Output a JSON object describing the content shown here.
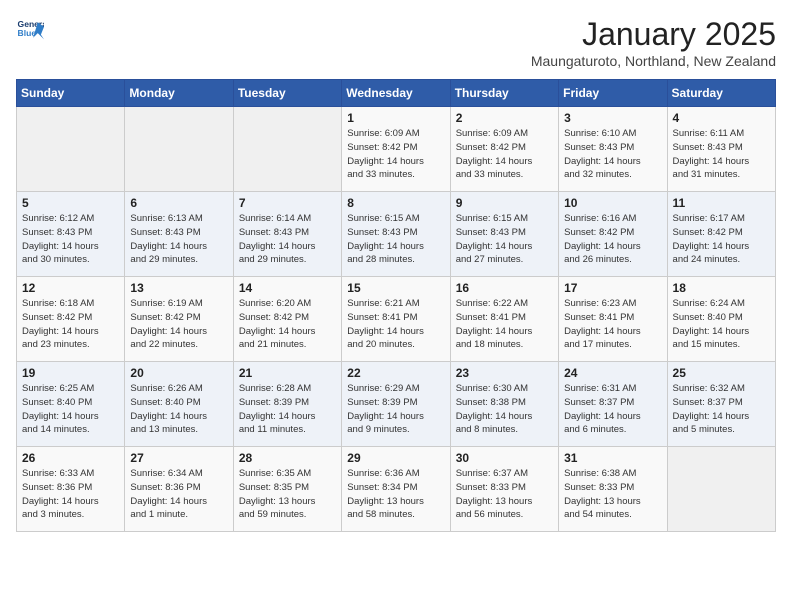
{
  "header": {
    "logo_general": "General",
    "logo_blue": "Blue",
    "month": "January 2025",
    "location": "Maungaturoto, Northland, New Zealand"
  },
  "weekdays": [
    "Sunday",
    "Monday",
    "Tuesday",
    "Wednesday",
    "Thursday",
    "Friday",
    "Saturday"
  ],
  "weeks": [
    [
      {
        "day": "",
        "info": ""
      },
      {
        "day": "",
        "info": ""
      },
      {
        "day": "",
        "info": ""
      },
      {
        "day": "1",
        "info": "Sunrise: 6:09 AM\nSunset: 8:42 PM\nDaylight: 14 hours\nand 33 minutes."
      },
      {
        "day": "2",
        "info": "Sunrise: 6:09 AM\nSunset: 8:42 PM\nDaylight: 14 hours\nand 33 minutes."
      },
      {
        "day": "3",
        "info": "Sunrise: 6:10 AM\nSunset: 8:43 PM\nDaylight: 14 hours\nand 32 minutes."
      },
      {
        "day": "4",
        "info": "Sunrise: 6:11 AM\nSunset: 8:43 PM\nDaylight: 14 hours\nand 31 minutes."
      }
    ],
    [
      {
        "day": "5",
        "info": "Sunrise: 6:12 AM\nSunset: 8:43 PM\nDaylight: 14 hours\nand 30 minutes."
      },
      {
        "day": "6",
        "info": "Sunrise: 6:13 AM\nSunset: 8:43 PM\nDaylight: 14 hours\nand 29 minutes."
      },
      {
        "day": "7",
        "info": "Sunrise: 6:14 AM\nSunset: 8:43 PM\nDaylight: 14 hours\nand 29 minutes."
      },
      {
        "day": "8",
        "info": "Sunrise: 6:15 AM\nSunset: 8:43 PM\nDaylight: 14 hours\nand 28 minutes."
      },
      {
        "day": "9",
        "info": "Sunrise: 6:15 AM\nSunset: 8:43 PM\nDaylight: 14 hours\nand 27 minutes."
      },
      {
        "day": "10",
        "info": "Sunrise: 6:16 AM\nSunset: 8:42 PM\nDaylight: 14 hours\nand 26 minutes."
      },
      {
        "day": "11",
        "info": "Sunrise: 6:17 AM\nSunset: 8:42 PM\nDaylight: 14 hours\nand 24 minutes."
      }
    ],
    [
      {
        "day": "12",
        "info": "Sunrise: 6:18 AM\nSunset: 8:42 PM\nDaylight: 14 hours\nand 23 minutes."
      },
      {
        "day": "13",
        "info": "Sunrise: 6:19 AM\nSunset: 8:42 PM\nDaylight: 14 hours\nand 22 minutes."
      },
      {
        "day": "14",
        "info": "Sunrise: 6:20 AM\nSunset: 8:42 PM\nDaylight: 14 hours\nand 21 minutes."
      },
      {
        "day": "15",
        "info": "Sunrise: 6:21 AM\nSunset: 8:41 PM\nDaylight: 14 hours\nand 20 minutes."
      },
      {
        "day": "16",
        "info": "Sunrise: 6:22 AM\nSunset: 8:41 PM\nDaylight: 14 hours\nand 18 minutes."
      },
      {
        "day": "17",
        "info": "Sunrise: 6:23 AM\nSunset: 8:41 PM\nDaylight: 14 hours\nand 17 minutes."
      },
      {
        "day": "18",
        "info": "Sunrise: 6:24 AM\nSunset: 8:40 PM\nDaylight: 14 hours\nand 15 minutes."
      }
    ],
    [
      {
        "day": "19",
        "info": "Sunrise: 6:25 AM\nSunset: 8:40 PM\nDaylight: 14 hours\nand 14 minutes."
      },
      {
        "day": "20",
        "info": "Sunrise: 6:26 AM\nSunset: 8:40 PM\nDaylight: 14 hours\nand 13 minutes."
      },
      {
        "day": "21",
        "info": "Sunrise: 6:28 AM\nSunset: 8:39 PM\nDaylight: 14 hours\nand 11 minutes."
      },
      {
        "day": "22",
        "info": "Sunrise: 6:29 AM\nSunset: 8:39 PM\nDaylight: 14 hours\nand 9 minutes."
      },
      {
        "day": "23",
        "info": "Sunrise: 6:30 AM\nSunset: 8:38 PM\nDaylight: 14 hours\nand 8 minutes."
      },
      {
        "day": "24",
        "info": "Sunrise: 6:31 AM\nSunset: 8:37 PM\nDaylight: 14 hours\nand 6 minutes."
      },
      {
        "day": "25",
        "info": "Sunrise: 6:32 AM\nSunset: 8:37 PM\nDaylight: 14 hours\nand 5 minutes."
      }
    ],
    [
      {
        "day": "26",
        "info": "Sunrise: 6:33 AM\nSunset: 8:36 PM\nDaylight: 14 hours\nand 3 minutes."
      },
      {
        "day": "27",
        "info": "Sunrise: 6:34 AM\nSunset: 8:36 PM\nDaylight: 14 hours\nand 1 minute."
      },
      {
        "day": "28",
        "info": "Sunrise: 6:35 AM\nSunset: 8:35 PM\nDaylight: 13 hours\nand 59 minutes."
      },
      {
        "day": "29",
        "info": "Sunrise: 6:36 AM\nSunset: 8:34 PM\nDaylight: 13 hours\nand 58 minutes."
      },
      {
        "day": "30",
        "info": "Sunrise: 6:37 AM\nSunset: 8:33 PM\nDaylight: 13 hours\nand 56 minutes."
      },
      {
        "day": "31",
        "info": "Sunrise: 6:38 AM\nSunset: 8:33 PM\nDaylight: 13 hours\nand 54 minutes."
      },
      {
        "day": "",
        "info": ""
      }
    ]
  ]
}
